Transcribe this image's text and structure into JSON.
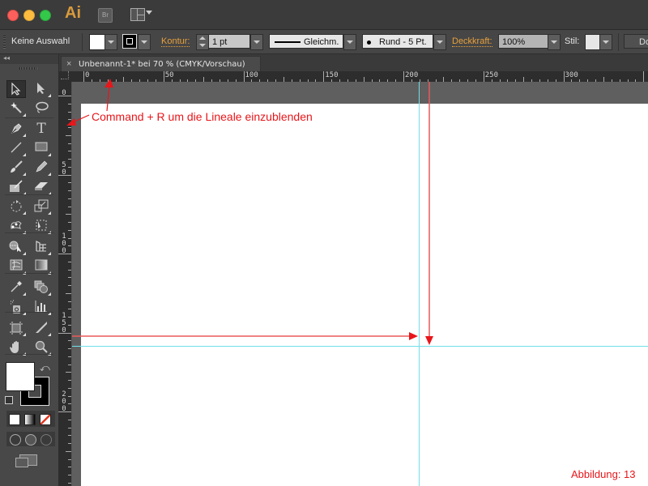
{
  "app": {
    "logo": "Ai",
    "bridge_label": "Br"
  },
  "control_bar": {
    "selection_status": "Keine Auswahl",
    "stroke_label": "Kontur:",
    "stroke_weight": "1 pt",
    "stroke_profile": "Gleichm.",
    "brush": "Rund - 5 Pt.",
    "opacity_label": "Deckkraft:",
    "opacity_value": "100%",
    "style_label": "Stil:",
    "doc_button": "Do"
  },
  "document": {
    "tab_title": "Unbenannt-1* bei 70 % (CMYK/Vorschau)",
    "close_glyph": "×"
  },
  "rulers": {
    "horizontal_labels": [
      "0",
      "50",
      "100",
      "150",
      "200",
      "250",
      "300"
    ],
    "vertical_labels": [
      "0",
      "50",
      "100",
      "150",
      "200"
    ]
  },
  "tools": [
    {
      "name": "selection-tool",
      "selected": true
    },
    {
      "name": "direct-selection-tool"
    },
    {
      "name": "magic-wand-tool"
    },
    {
      "name": "lasso-tool"
    },
    {
      "name": "pen-tool"
    },
    {
      "name": "type-tool",
      "glyph": "T"
    },
    {
      "name": "line-segment-tool"
    },
    {
      "name": "rectangle-tool"
    },
    {
      "name": "paintbrush-tool"
    },
    {
      "name": "pencil-tool"
    },
    {
      "name": "shaper-tool"
    },
    {
      "name": "eraser-tool"
    },
    {
      "name": "rotate-tool"
    },
    {
      "name": "scale-tool"
    },
    {
      "name": "puppet-warp-tool"
    },
    {
      "name": "free-transform-tool"
    },
    {
      "name": "shape-builder-tool"
    },
    {
      "name": "perspective-grid-tool"
    },
    {
      "name": "mesh-tool"
    },
    {
      "name": "gradient-tool"
    },
    {
      "name": "eyedropper-tool"
    },
    {
      "name": "blend-tool"
    },
    {
      "name": "symbol-sprayer-tool"
    },
    {
      "name": "column-graph-tool"
    },
    {
      "name": "artboard-tool"
    },
    {
      "name": "slice-tool"
    },
    {
      "name": "hand-tool"
    },
    {
      "name": "zoom-tool"
    }
  ],
  "annotation": {
    "text": "Command + R um die Lineale einzublenden",
    "figure_label": "Abbildung: 13"
  },
  "colors": {
    "annotation_red": "#e8161a",
    "guide_cyan": "#6fe0ea",
    "accent_orange": "#e8a03c"
  }
}
